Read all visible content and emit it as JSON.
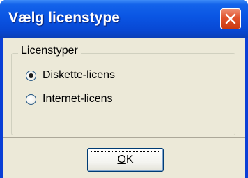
{
  "window": {
    "title": "Vælg licenstype",
    "close_icon": "close-icon"
  },
  "group": {
    "label": "Licenstyper",
    "options": [
      {
        "label": "Diskette-licens",
        "selected": true
      },
      {
        "label": "Internet-licens",
        "selected": false
      }
    ]
  },
  "buttons": {
    "ok_label": "OK",
    "ok_mnemonic": "O",
    "ok_rest": "K"
  },
  "colors": {
    "titlebar": "#0a55e3",
    "client": "#ece9d8",
    "close_button": "#e0522c"
  }
}
